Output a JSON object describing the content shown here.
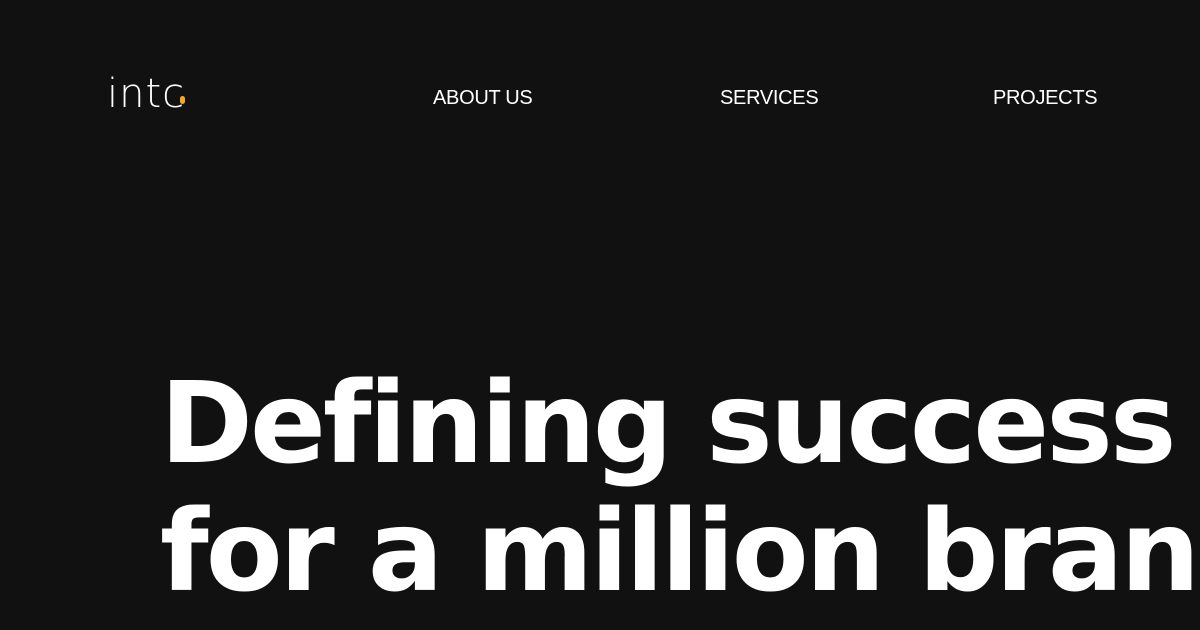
{
  "colors": {
    "background": "#111111",
    "text": "#ffffff",
    "accent": "#f5a623"
  },
  "header": {
    "logo": {
      "text": "intc",
      "dot_icon": "orange-dot-icon"
    },
    "nav": {
      "items": [
        {
          "label": "ABOUT US"
        },
        {
          "label": "SERVICES"
        },
        {
          "label": "PROJECTS"
        }
      ]
    }
  },
  "hero": {
    "headline_line_1": "Defining success",
    "headline_line_2": "for a million brands"
  }
}
